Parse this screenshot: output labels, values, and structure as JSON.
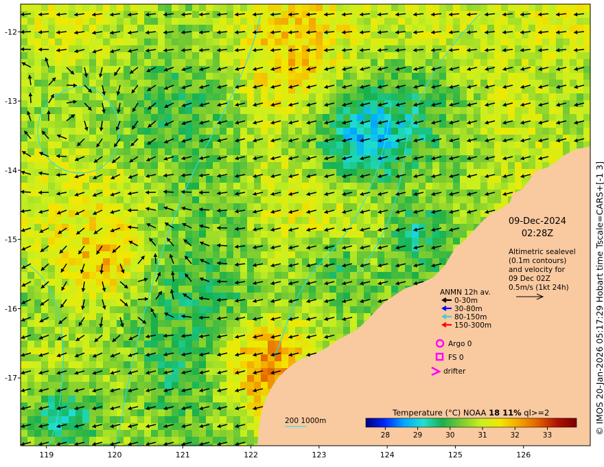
{
  "map": {
    "lon_ticks": [
      "119",
      "120",
      "121",
      "122",
      "123",
      "124",
      "125",
      "126"
    ],
    "lat_ticks": [
      "-12",
      "-13",
      "-14",
      "-15",
      "-16",
      "-17"
    ],
    "lon_range": [
      118.62,
      126.98
    ],
    "lat_range": [
      -17.98,
      -11.6
    ],
    "land_color": "#f9c9a0",
    "contour_color": "#33dddd"
  },
  "annotations": {
    "date": "09-Dec-2024",
    "time": "02:28Z",
    "sealevel_lines": [
      "Altimetric sealevel",
      "(0.1m contours)",
      "and velocity for",
      "09 Dec 02Z",
      "0.5m/s (1kt 24h)"
    ]
  },
  "legend": {
    "title": "ANMN 12h av.",
    "items": [
      {
        "label": "0-30m",
        "color": "#000000"
      },
      {
        "label": "30-80m",
        "color": "#0000ff"
      },
      {
        "label": "80-150m",
        "color": "#44cccc"
      },
      {
        "label": "150-300m",
        "color": "#ff0000"
      }
    ],
    "argo": "Argo 0",
    "fs": "FS 0",
    "drifter": "drifter",
    "marker_color": "#ff00ff"
  },
  "depth_legend": {
    "label": "200  1000m"
  },
  "colorbar": {
    "title": "Temperature (°C) NOAA ",
    "title_bold": "18 11%",
    "title_suffix": " ql>=2",
    "ticks": [
      "28",
      "29",
      "30",
      "31",
      "32",
      "33"
    ],
    "range": [
      27.4,
      33.9
    ],
    "colors": [
      "#00007f",
      "#0028ff",
      "#00a8ff",
      "#20e0d0",
      "#19b04c",
      "#7ccc30",
      "#c8f020",
      "#f2e800",
      "#f5a400",
      "#e06000",
      "#b01000",
      "#7a0000"
    ]
  },
  "credit": "© IMOS 20-Jan-2026 05:17:29 Hobart time Tscale=CARS+[-1 3]"
}
